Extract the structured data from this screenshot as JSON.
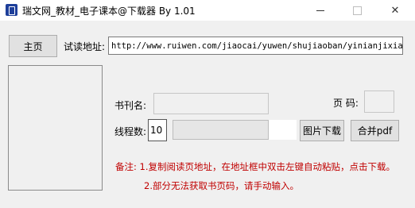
{
  "window": {
    "title": "瑞文网_教材_电子课本@下载器 By 1.01",
    "controls": {
      "minimize": "",
      "maximize": "",
      "close": "✕"
    }
  },
  "main": {
    "home_button": "主页",
    "url_label": "试读地址:",
    "url_value": "http://www.ruiwen.com/jiaocai/yuwen/shujiaoban/yinianjixiace/",
    "book_name_label": "书刊名:",
    "book_name_value": "",
    "page_label": "页 码:",
    "page_value": "",
    "threads_label": "线程数:",
    "threads_value": "10",
    "progress_value": "",
    "download_button": "图片下载",
    "merge_button": "合并pdf",
    "notes": [
      "备注: 1.复制阅读页地址，在地址框中双击左键自动粘贴，点击下载。",
      "2.部分无法获取书页码，请手动输入。"
    ]
  }
}
